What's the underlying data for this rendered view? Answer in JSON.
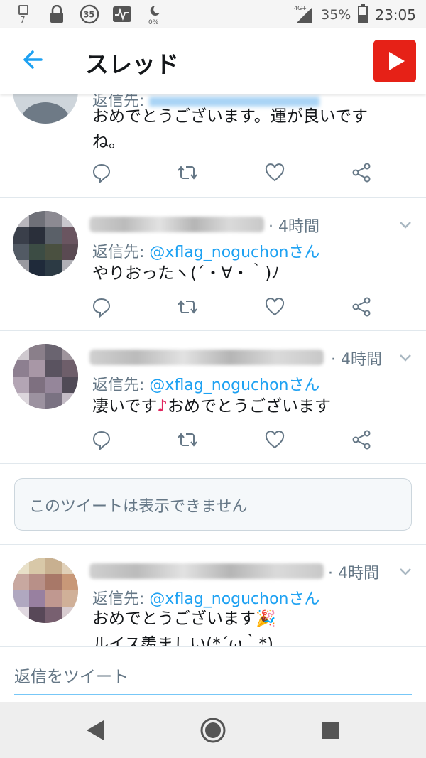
{
  "status_bar": {
    "left_icons": [
      "sim-7-icon",
      "lock-icon",
      "notification-35-icon",
      "activity-icon",
      "moon-0pct-icon"
    ],
    "badge_35": "35",
    "network": "4G+",
    "battery_pct": "35%",
    "time": "23:05"
  },
  "app_bar": {
    "title": "スレッド",
    "back_icon": "arrow-left-icon",
    "youtube_icon": "youtube-icon",
    "accent_color": "#1da1f2"
  },
  "tweets": [
    {
      "reply_prefix": "返信先:",
      "text_line1": "おめでとうございます。運が良いです",
      "text_line2": "ね。"
    },
    {
      "time": "· 4時間",
      "reply_prefix": "返信先:",
      "reply_handle": "@xflag_noguchonさん",
      "text": "やりおったヽ(´・∀・｀)ﾉ"
    },
    {
      "time": "· 4時間",
      "reply_prefix": "返信先:",
      "reply_handle": "@xflag_noguchonさん",
      "text_before": "凄いです",
      "emoji": "♪",
      "text_after": "おめでとうございます"
    },
    {
      "time": "· 4時間",
      "reply_prefix": "返信先:",
      "reply_handle": "@xflag_noguchonさん",
      "text_line1": "おめでとうございます🎉",
      "text_line2": "ルイス羨ましい(*´ω｀*)"
    }
  ],
  "unavailable_text": "このツイートは表示できません",
  "reply_placeholder": "返信をツイート",
  "nav": [
    "back-triangle-icon",
    "home-circle-icon",
    "recents-square-icon"
  ]
}
